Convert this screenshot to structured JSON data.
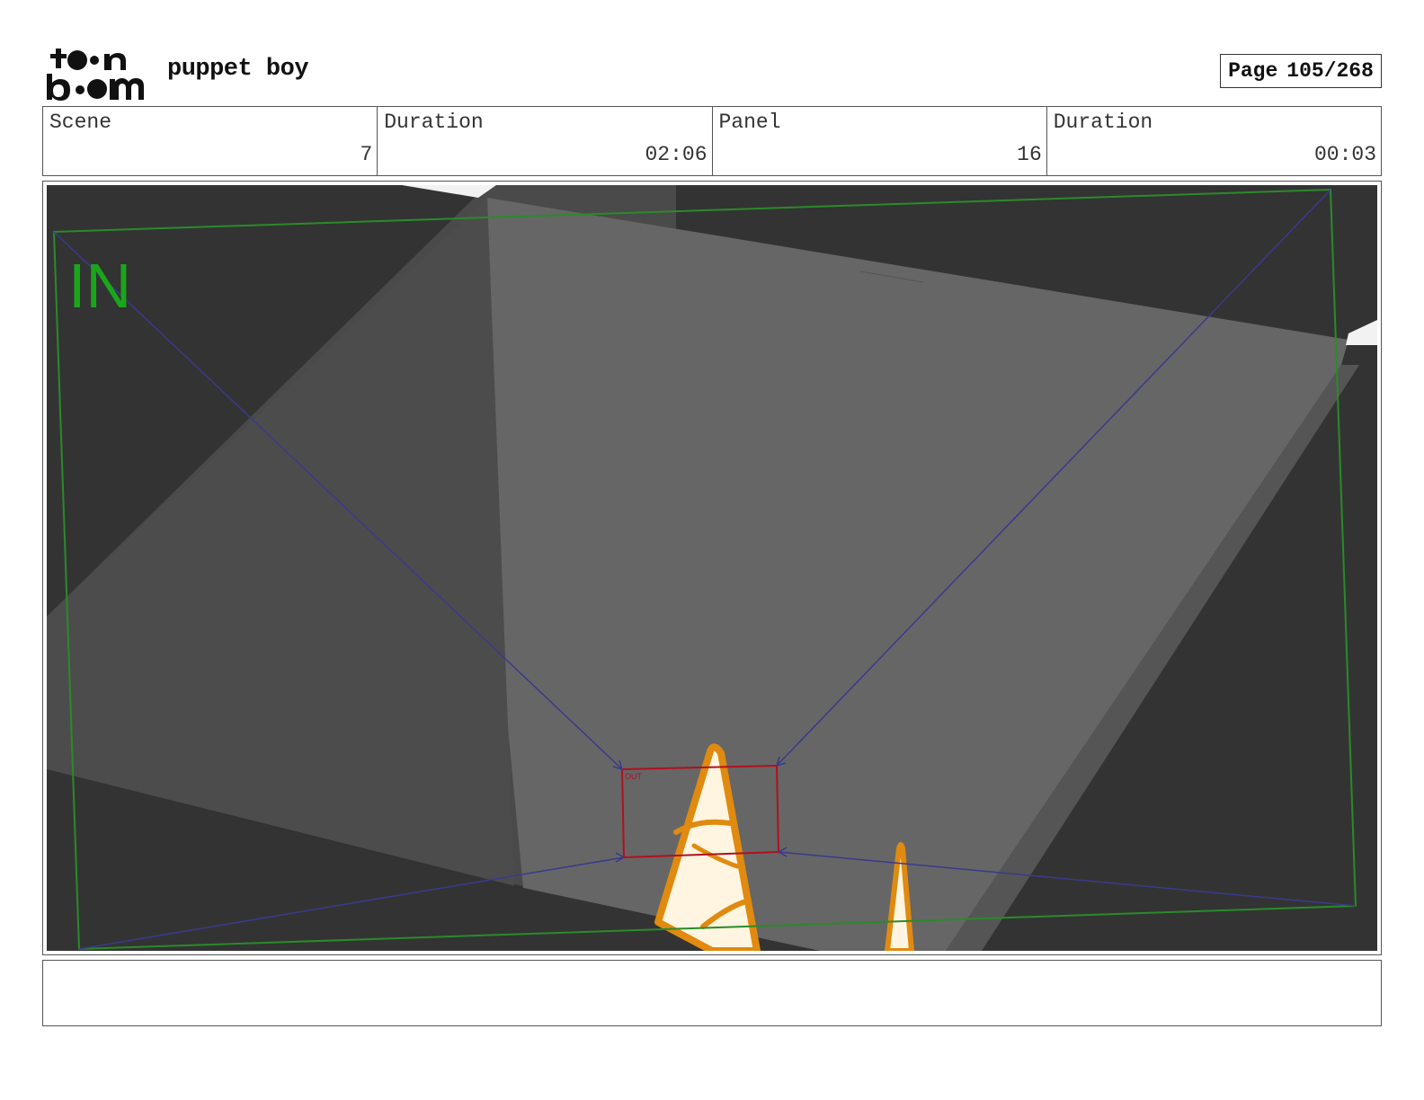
{
  "header": {
    "logo_text_top": "toon",
    "logo_text_bottom": "boom",
    "project_title": "puppet boy",
    "page_label": "Page",
    "page_number": "105/268"
  },
  "info": {
    "scene_label": "Scene",
    "scene_value": "7",
    "scene_duration_label": "Duration",
    "scene_duration_value": "02:06",
    "panel_label": "Panel",
    "panel_value": "16",
    "panel_duration_label": "Duration",
    "panel_duration_value": "00:03"
  },
  "panel": {
    "in_marker": "IN",
    "out_marker": "OUT",
    "colors": {
      "background_dark": "#333333",
      "light_plane": "#666666",
      "mid_plane": "#4a4a4a",
      "camera_in": "#2a8a2a",
      "camera_out": "#b01020",
      "motion_path": "#3a3a8c",
      "in_text": "#1aa61a",
      "spike_fill": "#fff5e0",
      "spike_outline": "#e08a10"
    }
  },
  "notes": {
    "text": ""
  }
}
